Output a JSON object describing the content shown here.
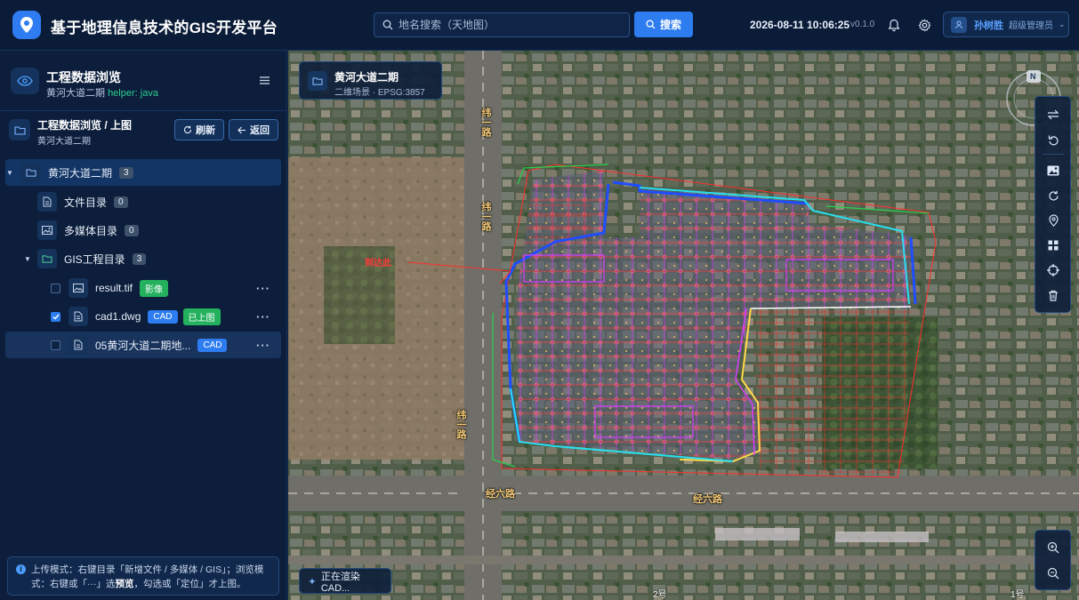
{
  "header": {
    "app_title": "基于地理信息技术的GIS开发平台",
    "search_placeholder": "地名搜索（天地图）",
    "search_button": "搜索",
    "datetime": "2026-08-11 10:06:25",
    "version": "v0.1.0",
    "user_name": "孙树胜",
    "user_role": "超级管理员"
  },
  "sidebar": {
    "title": "工程数据浏览",
    "subtitle_project": "黄河大道二期",
    "subtitle_helper": "helper: java",
    "crumb_title": "工程数据浏览 / 上图",
    "crumb_sub": "黄河大道二期",
    "refresh_label": "刷新",
    "back_label": "返回",
    "tree": {
      "root": {
        "label": "黄河大道二期",
        "count": "3"
      },
      "files": {
        "label": "文件目录",
        "count": "0"
      },
      "media": {
        "label": "多媒体目录",
        "count": "0"
      },
      "gis": {
        "label": "GIS工程目录",
        "count": "3"
      },
      "items": [
        {
          "label": "result.tif",
          "tag": "影像",
          "tag2": "",
          "checked": false
        },
        {
          "label": "cad1.dwg",
          "tag": "CAD",
          "tag2": "已上图",
          "checked": true
        },
        {
          "label": "05黄河大道二期地...",
          "tag": "CAD",
          "tag2": "",
          "checked": false
        }
      ],
      "more_label": "···"
    },
    "note_prefix": "上传模式：右键目录「新增文件 / 多媒体 / GIS」；浏览模式：右键或「···」选",
    "note_bold": "预览",
    "note_suffix": "，勾选或「定位」才上图。"
  },
  "map": {
    "scene_title": "黄河大道二期",
    "scene_sub": "二维场景 · EPSG:3857",
    "status": "正在渲染 CAD...",
    "compass_letter": "N",
    "road_labels": [
      "经六路",
      "经六路",
      "纬一路",
      "纬一路",
      "纬一路"
    ],
    "cad_annotation": "到达此",
    "bottom_labels": [
      "2号",
      "1号"
    ]
  },
  "colors": {
    "accent": "#2d7cf0",
    "tag_green": "#24b15e",
    "helper_green": "#2fce8f",
    "cad_red": "#ff3b3b",
    "cad_magenta": "#d63cff",
    "cad_blue": "#1f4dff",
    "cad_cyan": "#27e0f0"
  },
  "icons": {
    "logo": "map-pin-icon",
    "toolbar": [
      "swap-icon",
      "undo-icon",
      "image-icon",
      "refresh-icon",
      "location-icon",
      "grid-icon",
      "target-icon",
      "trash-icon"
    ],
    "zoom": [
      "zoom-in-icon",
      "zoom-out-icon"
    ]
  }
}
